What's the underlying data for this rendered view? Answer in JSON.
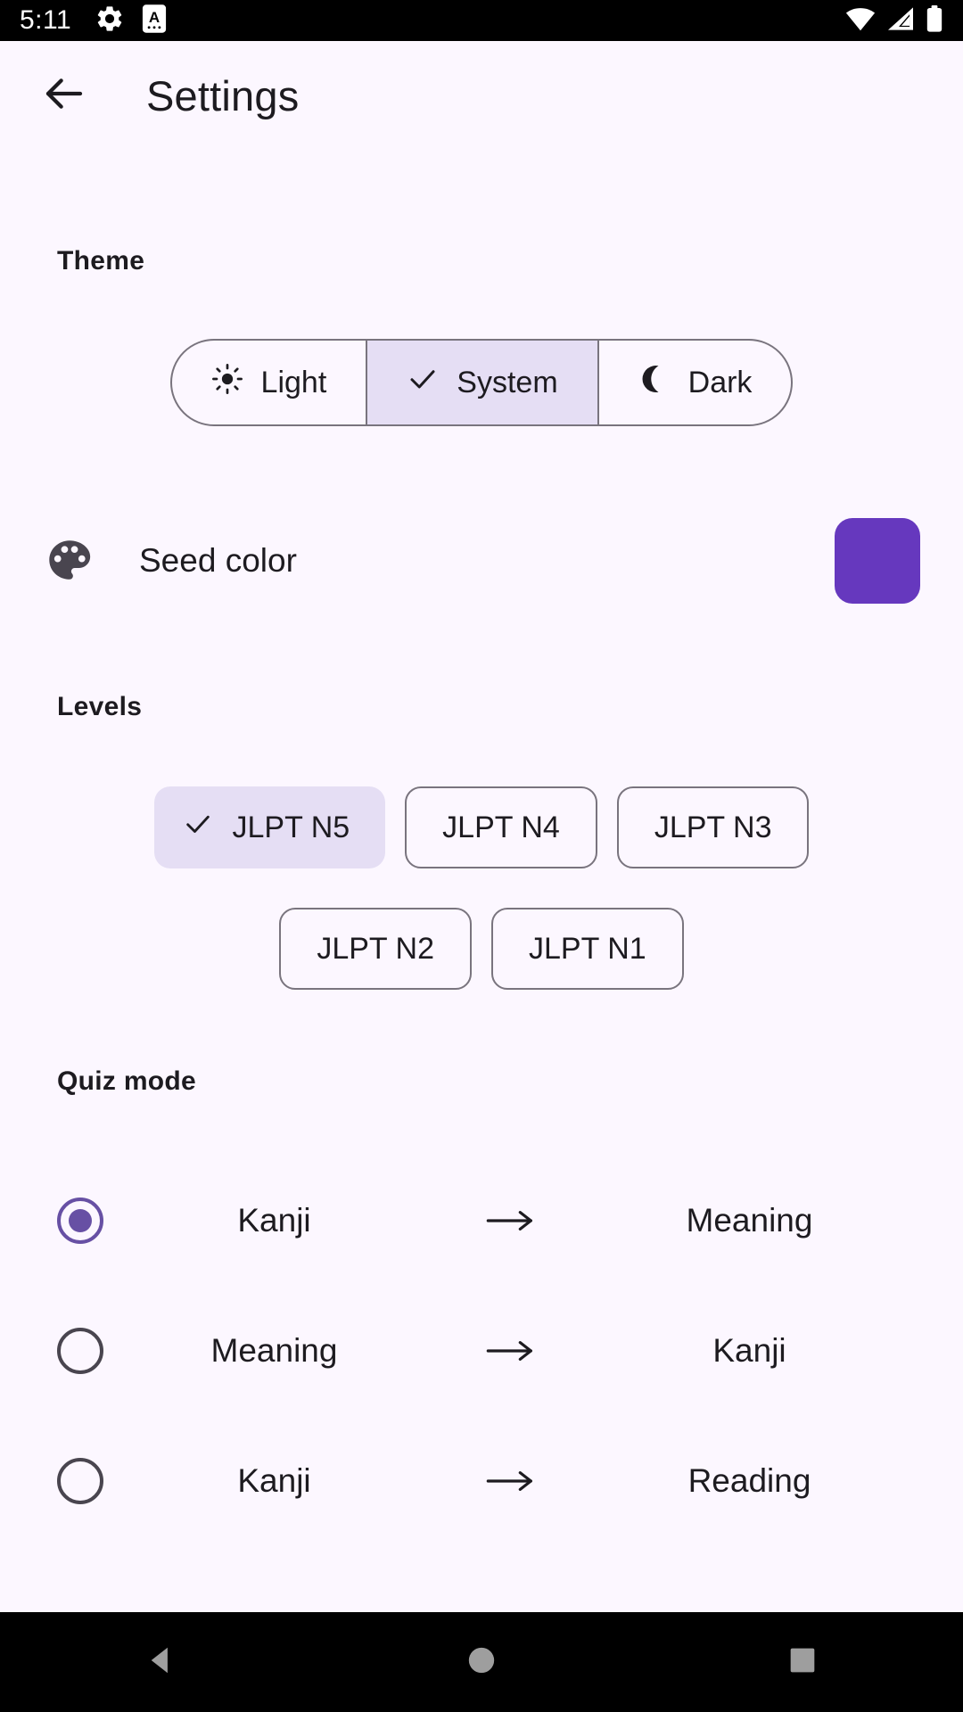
{
  "status_bar": {
    "clock": "5:11",
    "left_icons": [
      "settings-gear-icon",
      "accessibility-a-icon"
    ],
    "right_icons": [
      "wifi-icon",
      "cellular-signal-icon",
      "battery-icon"
    ],
    "background": "#000000",
    "foreground": "#FFFFFF"
  },
  "app_bar": {
    "back_icon": "back-arrow-icon",
    "title": "Settings"
  },
  "theme": {
    "section_label": "Theme",
    "segments": [
      {
        "label": "Light",
        "icon": "sun-icon",
        "selected": false
      },
      {
        "label": "System",
        "icon": "check-icon",
        "selected": true
      },
      {
        "label": "Dark",
        "icon": "moon-icon",
        "selected": false
      }
    ],
    "selected_background": "#E5DEF4",
    "outline_color": "#79747E"
  },
  "seed_color": {
    "icon": "palette-icon",
    "label": "Seed color",
    "swatch_color": "#6638BE"
  },
  "levels": {
    "section_label": "Levels",
    "chips": [
      {
        "label": "JLPT N5",
        "selected": true
      },
      {
        "label": "JLPT N4",
        "selected": false
      },
      {
        "label": "JLPT N3",
        "selected": false
      },
      {
        "label": "JLPT N2",
        "selected": false
      },
      {
        "label": "JLPT N1",
        "selected": false
      }
    ]
  },
  "quiz_mode": {
    "section_label": "Quiz mode",
    "options": [
      {
        "from": "Kanji",
        "arrow": "→",
        "to": "Meaning",
        "selected": true
      },
      {
        "from": "Meaning",
        "arrow": "→",
        "to": "Kanji",
        "selected": false
      },
      {
        "from": "Kanji",
        "arrow": "→",
        "to": "Reading",
        "selected": false
      }
    ],
    "accent_color": "#6750A4"
  },
  "nav_bar": {
    "buttons": [
      "back-triangle-icon",
      "home-circle-icon",
      "recents-square-icon"
    ],
    "background": "#000000"
  }
}
